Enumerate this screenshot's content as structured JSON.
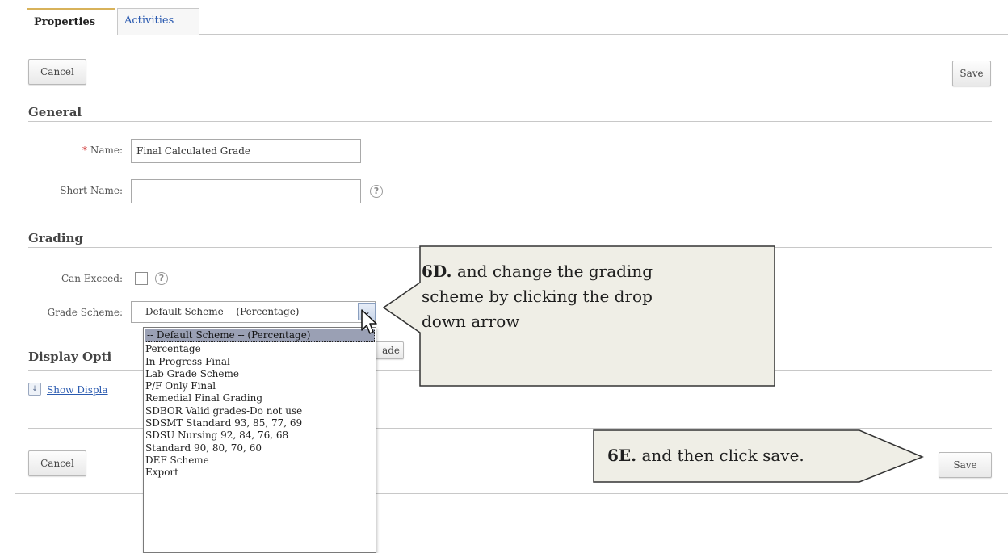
{
  "tabs": [
    {
      "label": "Properties"
    },
    {
      "label": "Activities"
    }
  ],
  "toolbar": {
    "cancel_label": "Cancel",
    "save_label": "Save"
  },
  "general": {
    "heading": "General",
    "name_required_mark": "*",
    "name_label": "Name:",
    "name_value": "Final Calculated Grade",
    "short_name_label": "Short Name:",
    "short_name_value": "",
    "help_icon": "question-circle-icon"
  },
  "grading": {
    "heading": "Grading",
    "can_exceed_label": "Can Exceed:",
    "can_exceed_checked": false,
    "grade_scheme_label": "Grade Scheme:",
    "grade_scheme_selected": "-- Default Scheme -- (Percentage)",
    "grade_scheme_options": [
      "-- Default Scheme -- (Percentage)",
      "Percentage",
      "In Progress Final",
      "Lab Grade Scheme",
      "P/F Only Final",
      "Remedial Final Grading",
      "SDBOR Valid grades-Do not use",
      "SDSMT Standard 93, 85, 77, 69",
      "SDSU Nursing 92, 84, 76, 68",
      "Standard 90, 80, 70, 60",
      "DEF Scheme",
      "Export"
    ],
    "partial_button_text": "ade"
  },
  "display_options": {
    "heading_visible": "Display Opti",
    "link_visible": "Show Displa"
  },
  "bottom": {
    "cancel_label": "Cancel",
    "save_label": "Save"
  },
  "callouts": {
    "c6d_step": "6D.",
    "c6d_line1": "and change the grading",
    "c6d_line2": "scheme by clicking the drop",
    "c6d_line3": "down arrow",
    "c6e_step": "6E.",
    "c6e_text": "and then click save."
  },
  "colors": {
    "callout_fill": "#efeee6",
    "tab_accent": "#d8b25a",
    "link": "#2a5ab0",
    "required": "#d23b3b"
  }
}
